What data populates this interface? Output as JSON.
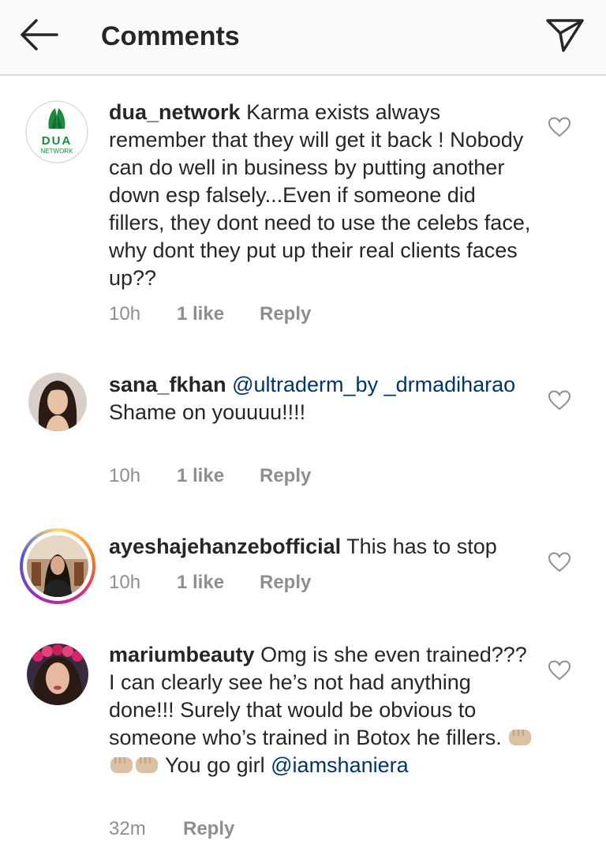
{
  "header": {
    "title": "Comments",
    "back_icon": "arrow-left-icon",
    "share_icon": "paper-plane-icon"
  },
  "comments": [
    {
      "username": "dua_network",
      "text": "Karma exists always remember that they will get it back ! Nobody can do well in business by putting another down esp falsely...Even if someone did fillers, they dont need to use the celebs face, why dont they put up their real clients faces up??",
      "time": "10h",
      "likes": "1 like",
      "reply": "Reply",
      "avatar_text": "DUA",
      "avatar_subtext": "NETWORK"
    },
    {
      "username": "sana_fkhan",
      "mention": "@ultraderm_by _drmadiharao",
      "text": "Shame on youuuu!!!!",
      "time": "10h",
      "likes": "1 like",
      "reply": "Reply"
    },
    {
      "username": "ayeshajehanzebofficial",
      "text": "This has to stop",
      "time": "10h",
      "likes": "1 like",
      "reply": "Reply"
    },
    {
      "username": "mariumbeauty",
      "text_before": "Omg is she even trained??? I can clearly see he’s not had anything done!!! Surely that would be obvious to someone who’s trained in Botox he fillers.",
      "text_after": "You go girl",
      "mention": "@iamshaniera",
      "emoji_icon": "fist-bump-emoji",
      "time": "32m",
      "reply": "Reply"
    }
  ],
  "colors": {
    "text": "#262626",
    "meta": "#8e8e8e",
    "mention": "#003569",
    "header_bg": "#fafafa",
    "brand_green": "#1e8a3e"
  },
  "icons": {
    "like": "heart-outline-icon"
  }
}
